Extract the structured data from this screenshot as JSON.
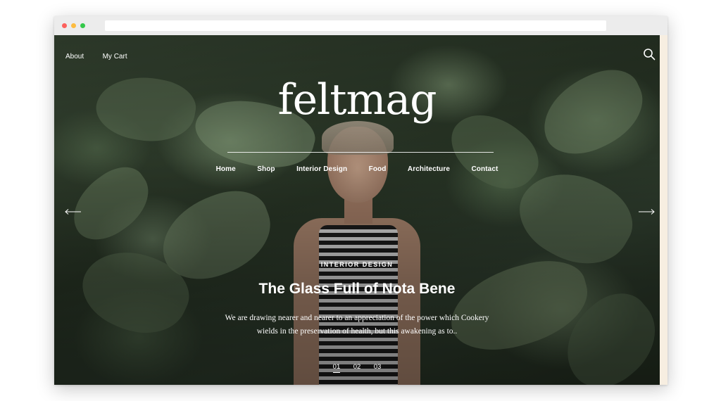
{
  "site": {
    "logo": "feltmag"
  },
  "topnav": {
    "about": "About",
    "cart": "My Cart"
  },
  "mainnav": {
    "items": [
      "Home",
      "Shop",
      "Interior Design",
      "Food",
      "Architecture",
      "Contact"
    ]
  },
  "hero": {
    "category": "INTERIOR DESIGN",
    "title": "The Glass Full of Nota Bene",
    "excerpt_line1": "We are drawing nearer and nearer to an appreciation of the power which Cookery",
    "excerpt_line2": "wields in the preservation of health, but this awakening as to.."
  },
  "pager": {
    "pages": [
      "01",
      "02",
      "03"
    ],
    "active": "01"
  },
  "icons": {
    "search": "search-icon",
    "prev": "arrow-left-icon",
    "next": "arrow-right-icon"
  },
  "colors": {
    "text": "#ffffff",
    "foliage": "#3a4a36",
    "right_strip": "#f7eee1"
  }
}
